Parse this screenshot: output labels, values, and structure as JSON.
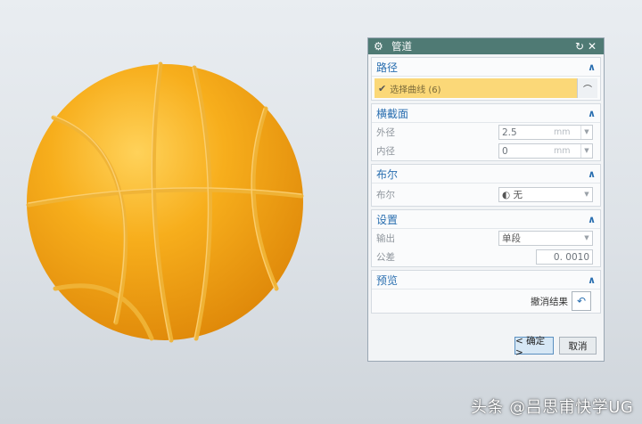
{
  "dialog": {
    "title": "管道",
    "sections": {
      "path": {
        "heading": "路径",
        "select_curve": "选择曲线 (6)"
      },
      "cross_section": {
        "heading": "横截面",
        "outer_label": "外径",
        "outer_value": "2.5",
        "outer_unit": "mm",
        "inner_label": "内径",
        "inner_value": "0",
        "inner_unit": "mm"
      },
      "boolean": {
        "heading": "布尔",
        "label": "布尔",
        "value": "无"
      },
      "settings": {
        "heading": "设置",
        "output_label": "输出",
        "output_value": "单段",
        "tolerance_label": "公差",
        "tolerance_value": "0. 0010"
      },
      "preview": {
        "heading": "预览",
        "undo_label": "撤消结果"
      }
    },
    "buttons": {
      "ok": "< 确定 >",
      "cancel": "取消"
    }
  },
  "watermark": "头条 @吕思甫快学UG",
  "colors": {
    "ball": "#f2a516",
    "title_bar": "#4f7a74",
    "heading": "#2a6fb0",
    "highlight": "#fbd878"
  }
}
